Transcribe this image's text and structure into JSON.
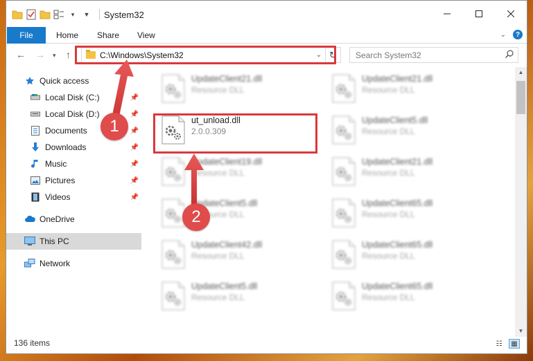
{
  "window": {
    "title": "System32"
  },
  "ribbon": {
    "file": "File",
    "tabs": [
      "Home",
      "Share",
      "View"
    ]
  },
  "address": {
    "path": "C:\\Windows\\System32"
  },
  "search": {
    "placeholder": "Search System32"
  },
  "sidebar": {
    "items": [
      {
        "label": "Quick access",
        "icon": "star-icon"
      },
      {
        "label": "Local Disk (C:)",
        "icon": "drive-icon",
        "pinned": true
      },
      {
        "label": "Local Disk (D:)",
        "icon": "drive-icon",
        "pinned": true
      },
      {
        "label": "Documents",
        "icon": "documents-icon",
        "pinned": true
      },
      {
        "label": "Downloads",
        "icon": "downloads-icon",
        "pinned": true
      },
      {
        "label": "Music",
        "icon": "music-icon",
        "pinned": true
      },
      {
        "label": "Pictures",
        "icon": "pictures-icon",
        "pinned": true
      },
      {
        "label": "Videos",
        "icon": "videos-icon",
        "pinned": true
      },
      {
        "label": "OneDrive",
        "icon": "cloud-icon"
      },
      {
        "label": "This PC",
        "icon": "computer-icon",
        "selected": true
      },
      {
        "label": "Network",
        "icon": "network-icon"
      }
    ]
  },
  "files": {
    "left": [
      {
        "name": "UpdateClient21.dll",
        "sub": "Resource DLL"
      },
      {
        "name": "ut_unload.dll",
        "sub": "2.0.0.309"
      },
      {
        "name": "UpdateClient19.dll",
        "sub": "Resource DLL"
      },
      {
        "name": "UpdateClient5.dll",
        "sub": "Resource DLL"
      },
      {
        "name": "UpdateClient42.dll",
        "sub": "Resource DLL"
      },
      {
        "name": "UpdateClient5.dll",
        "sub": "Resource DLL"
      }
    ],
    "right": [
      {
        "name": "UpdateClient21.dll",
        "sub": "Resource DLL"
      },
      {
        "name": "UpdateClient5.dll",
        "sub": "Resource DLL"
      },
      {
        "name": "UpdateClient21.dll",
        "sub": "Resource DLL"
      },
      {
        "name": "UpdateClient65.dll",
        "sub": "Resource DLL"
      },
      {
        "name": "UpdateClient65.dll",
        "sub": "Resource DLL"
      },
      {
        "name": "UpdateClient65.dll",
        "sub": "Resource DLL"
      }
    ]
  },
  "status": {
    "count": "136 items"
  },
  "callouts": {
    "one": "1",
    "two": "2"
  },
  "colors": {
    "accent": "#1979ca",
    "highlight": "#d9393c",
    "badge": "#e04b4b"
  }
}
